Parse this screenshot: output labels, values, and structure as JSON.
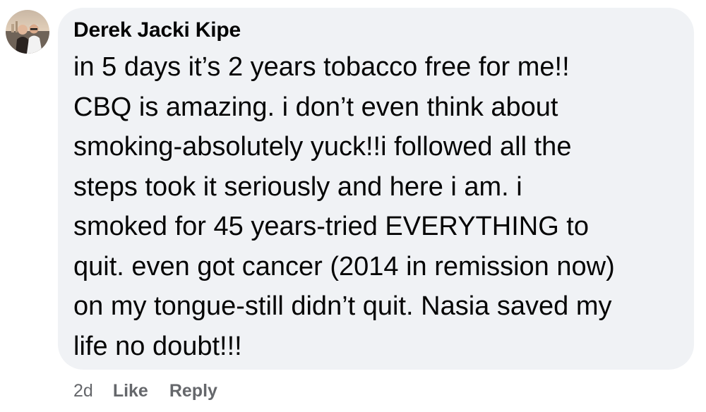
{
  "comment": {
    "author": "Derek Jacki Kipe",
    "avatar_icon": "profile-photo-icon",
    "text": "in 5 days it’s 2 years tobacco free for me!!\nCBQ is amazing. i don’t even think about\nsmoking-absolutely yuck!!i followed all the\nsteps took it seriously and here i am. i\nsmoked for 45 years-tried EVERYTHING to\nquit. even got cancer (2014 in remission now)\non my tongue-still didn’t quit. Nasia saved my\nlife no doubt!!!",
    "bubble_color": "#f0f2f5"
  },
  "actions": {
    "timestamp": "2d",
    "like_label": "Like",
    "reply_label": "Reply",
    "color": "#65676b"
  }
}
